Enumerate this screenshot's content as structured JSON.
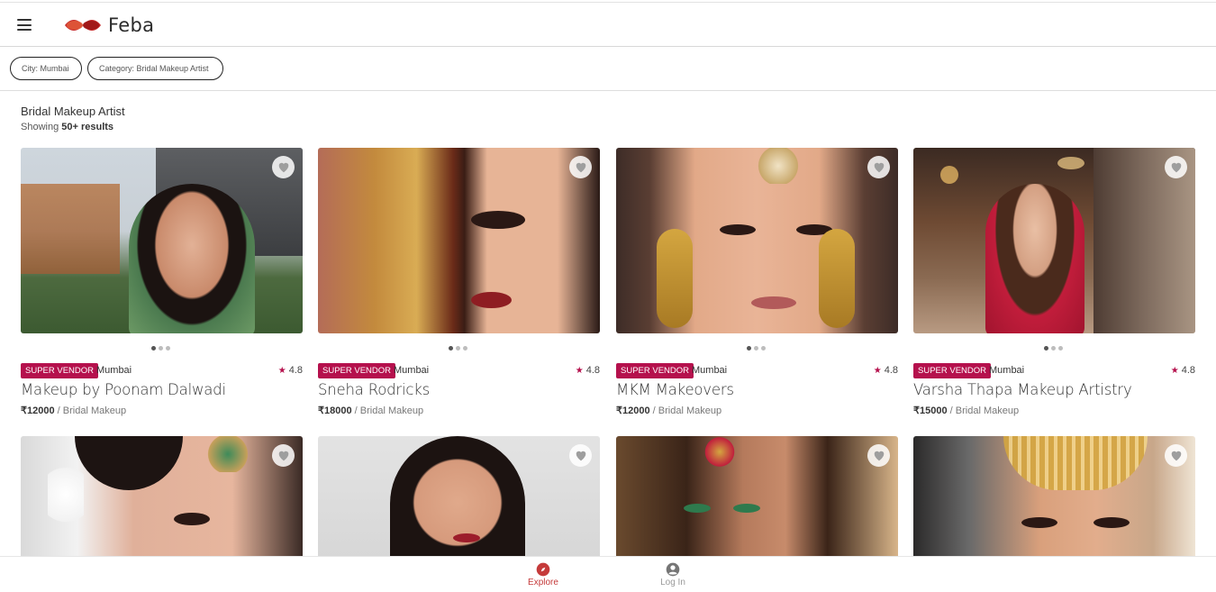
{
  "header": {
    "brand": "Feba",
    "menu_icon": "hamburger-icon",
    "logo_icon": "feba-logo-icon"
  },
  "filters": [
    {
      "label": "City: Mumbai"
    },
    {
      "label": "Category: Bridal Makeup Artist"
    }
  ],
  "listing": {
    "title": "Bridal Makeup Artist",
    "showing_label": "Showing",
    "count": "50+ results"
  },
  "cards": [
    {
      "badge": "SUPER VENDOR",
      "city": "Mumbai",
      "rating": "4.8",
      "name": "Makeup by Poonam Dalwadi",
      "price": "₹12000",
      "unit": "/ Bridal Makeup"
    },
    {
      "badge": "SUPER VENDOR",
      "city": "Mumbai",
      "rating": "4.8",
      "name": "Sneha Rodricks",
      "price": "₹18000",
      "unit": "/ Bridal Makeup"
    },
    {
      "badge": "SUPER VENDOR",
      "city": "Mumbai",
      "rating": "4.8",
      "name": "MKM Makeovers",
      "price": "₹12000",
      "unit": "/ Bridal Makeup"
    },
    {
      "badge": "SUPER VENDOR",
      "city": "Mumbai",
      "rating": "4.8",
      "name": "Varsha Thapa Makeup Artistry",
      "price": "₹15000",
      "unit": "/ Bridal Makeup"
    }
  ],
  "bottom_nav": {
    "explore": "Explore",
    "login": "Log In",
    "active_color": "#c53a3a"
  },
  "colors": {
    "accent": "#b5114d",
    "explore_active": "#c53a3a"
  }
}
